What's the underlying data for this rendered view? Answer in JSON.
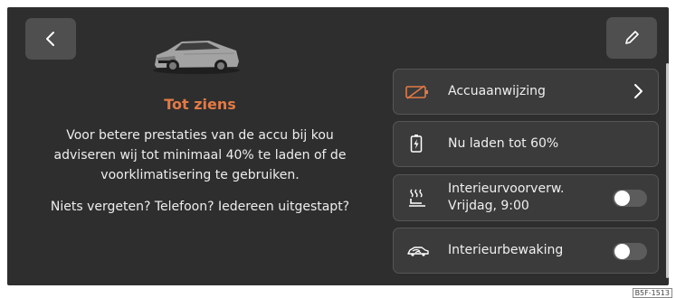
{
  "farewell": {
    "title": "Tot ziens",
    "message_lines": [
      "Voor betere prestaties van de accu bij kou",
      "adviseren wij tot minimaal 40% te laden of de",
      "voorklimatisering te gebruiken."
    ],
    "message2": "Niets vergeten? Telefoon? Iedereen uitgestapt?"
  },
  "items": [
    {
      "label": "Accuaanwijzing",
      "icon": "battery-warning-icon",
      "control": "chevron"
    },
    {
      "label": "Nu laden tot 60%",
      "icon": "charging-battery-icon",
      "control": "none"
    },
    {
      "label_lines": [
        "Interieurvoorverw.",
        "Vrijdag, 9:00"
      ],
      "icon": "seat-heating-icon",
      "control": "toggle",
      "toggle_on": false
    },
    {
      "label": "Interieurbewaking",
      "icon": "interior-monitoring-icon",
      "control": "toggle",
      "toggle_on": false
    }
  ],
  "colors": {
    "accent": "#e27a46",
    "background": "#2e2e2e",
    "item_background": "#3b3b3b"
  },
  "figure_code": "B5F-1513"
}
